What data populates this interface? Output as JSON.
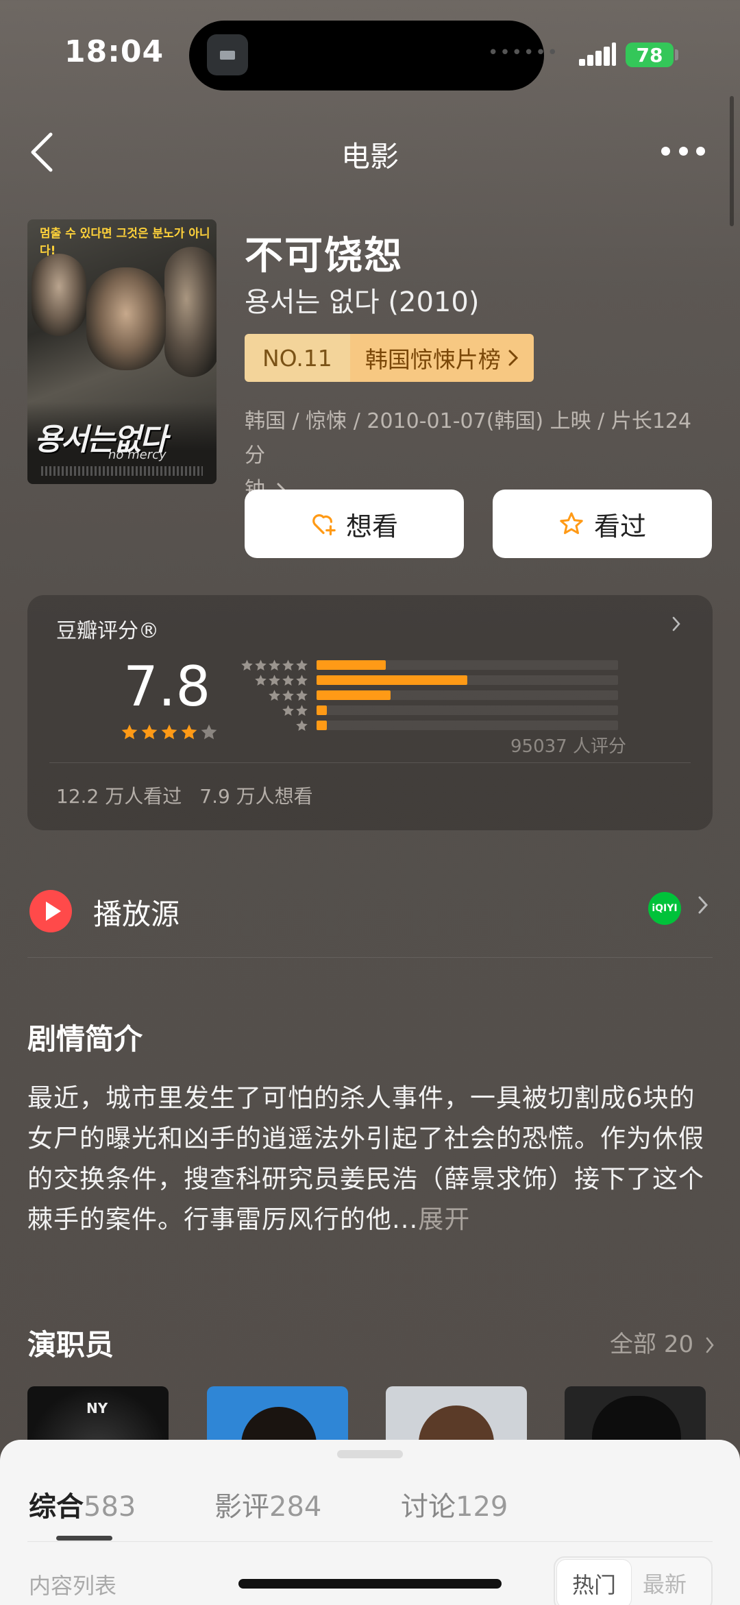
{
  "status_bar": {
    "time": "18:04",
    "battery": "78"
  },
  "nav": {
    "title": "电影"
  },
  "poster": {
    "tagline": "멈출 수 있다면 그것은 분노가 아니다!",
    "ko_title": "용서는없다",
    "en_title": "no mercy"
  },
  "movie": {
    "title": "不可饶恕",
    "original_title": "용서는 없다 (2010)",
    "rank_no": "NO.11",
    "rank_list": "韩国惊悚片榜",
    "meta_line1": "韩国 / 惊悚 / 2010-01-07(韩国) 上映 / 片长124分",
    "meta_line2": "钟"
  },
  "actions": {
    "want": "想看",
    "watched": "看过"
  },
  "rating": {
    "label": "豆瓣评分®",
    "score": "7.8",
    "stars": 4,
    "distribution": [
      {
        "stars": 5,
        "percent": 23
      },
      {
        "stars": 4,
        "percent": 50
      },
      {
        "stars": 3,
        "percent": 24.5
      },
      {
        "stars": 2,
        "percent": 3.5
      },
      {
        "stars": 1,
        "percent": 3.5
      }
    ],
    "votes": "95037 人评分",
    "watched": "12.2 万人看过",
    "wanted": "7.9 万人想看"
  },
  "play_source": {
    "label": "播放源",
    "provider_icon": "iqiyi-icon"
  },
  "synopsis": {
    "title": "剧情简介",
    "text": "最近，城市里发生了可怕的杀人事件，一具被切割成6块的女尸的曝光和凶手的逍遥法外引起了社会的恐慌。作为休假的交换条件，搜查科研究员姜民浩（薛景求饰）接下了这个棘手的案件。行事雷厉风行的他...",
    "more": "展开"
  },
  "cast": {
    "title": "演职员",
    "all_label": "全部",
    "count": "20"
  },
  "sheet": {
    "tabs": [
      {
        "label": "综合",
        "count": "583"
      },
      {
        "label": "影评",
        "count": "284"
      },
      {
        "label": "讨论",
        "count": "129"
      }
    ],
    "content_list": "内容列表",
    "sort_hot": "热门",
    "sort_new": "最新"
  },
  "colors": {
    "accent_orange": "#ff9a16",
    "rank_badge": "#f7c882",
    "play_red": "#ff4a4a",
    "iqiyi_green": "#00c23a"
  }
}
